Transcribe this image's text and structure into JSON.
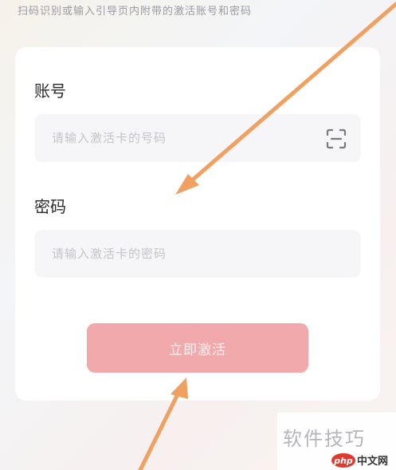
{
  "instruction_text": "扫码识别或输入引导页内附带的激活账号和密码",
  "form": {
    "account_label": "账号",
    "account_placeholder": "请输入激活卡的号码",
    "password_label": "密码",
    "password_placeholder": "请输入激活卡的密码",
    "activate_button_label": "立即激活"
  },
  "icons": {
    "scan": "scan-icon"
  },
  "colors": {
    "button_bg": "#f1a9ab",
    "arrow": "#f0a060",
    "label_text": "#2b2b2b",
    "input_bg": "#f6f6f8"
  },
  "watermark": {
    "text": "软件技巧",
    "logo_text": "php",
    "site_text": "中文网"
  }
}
